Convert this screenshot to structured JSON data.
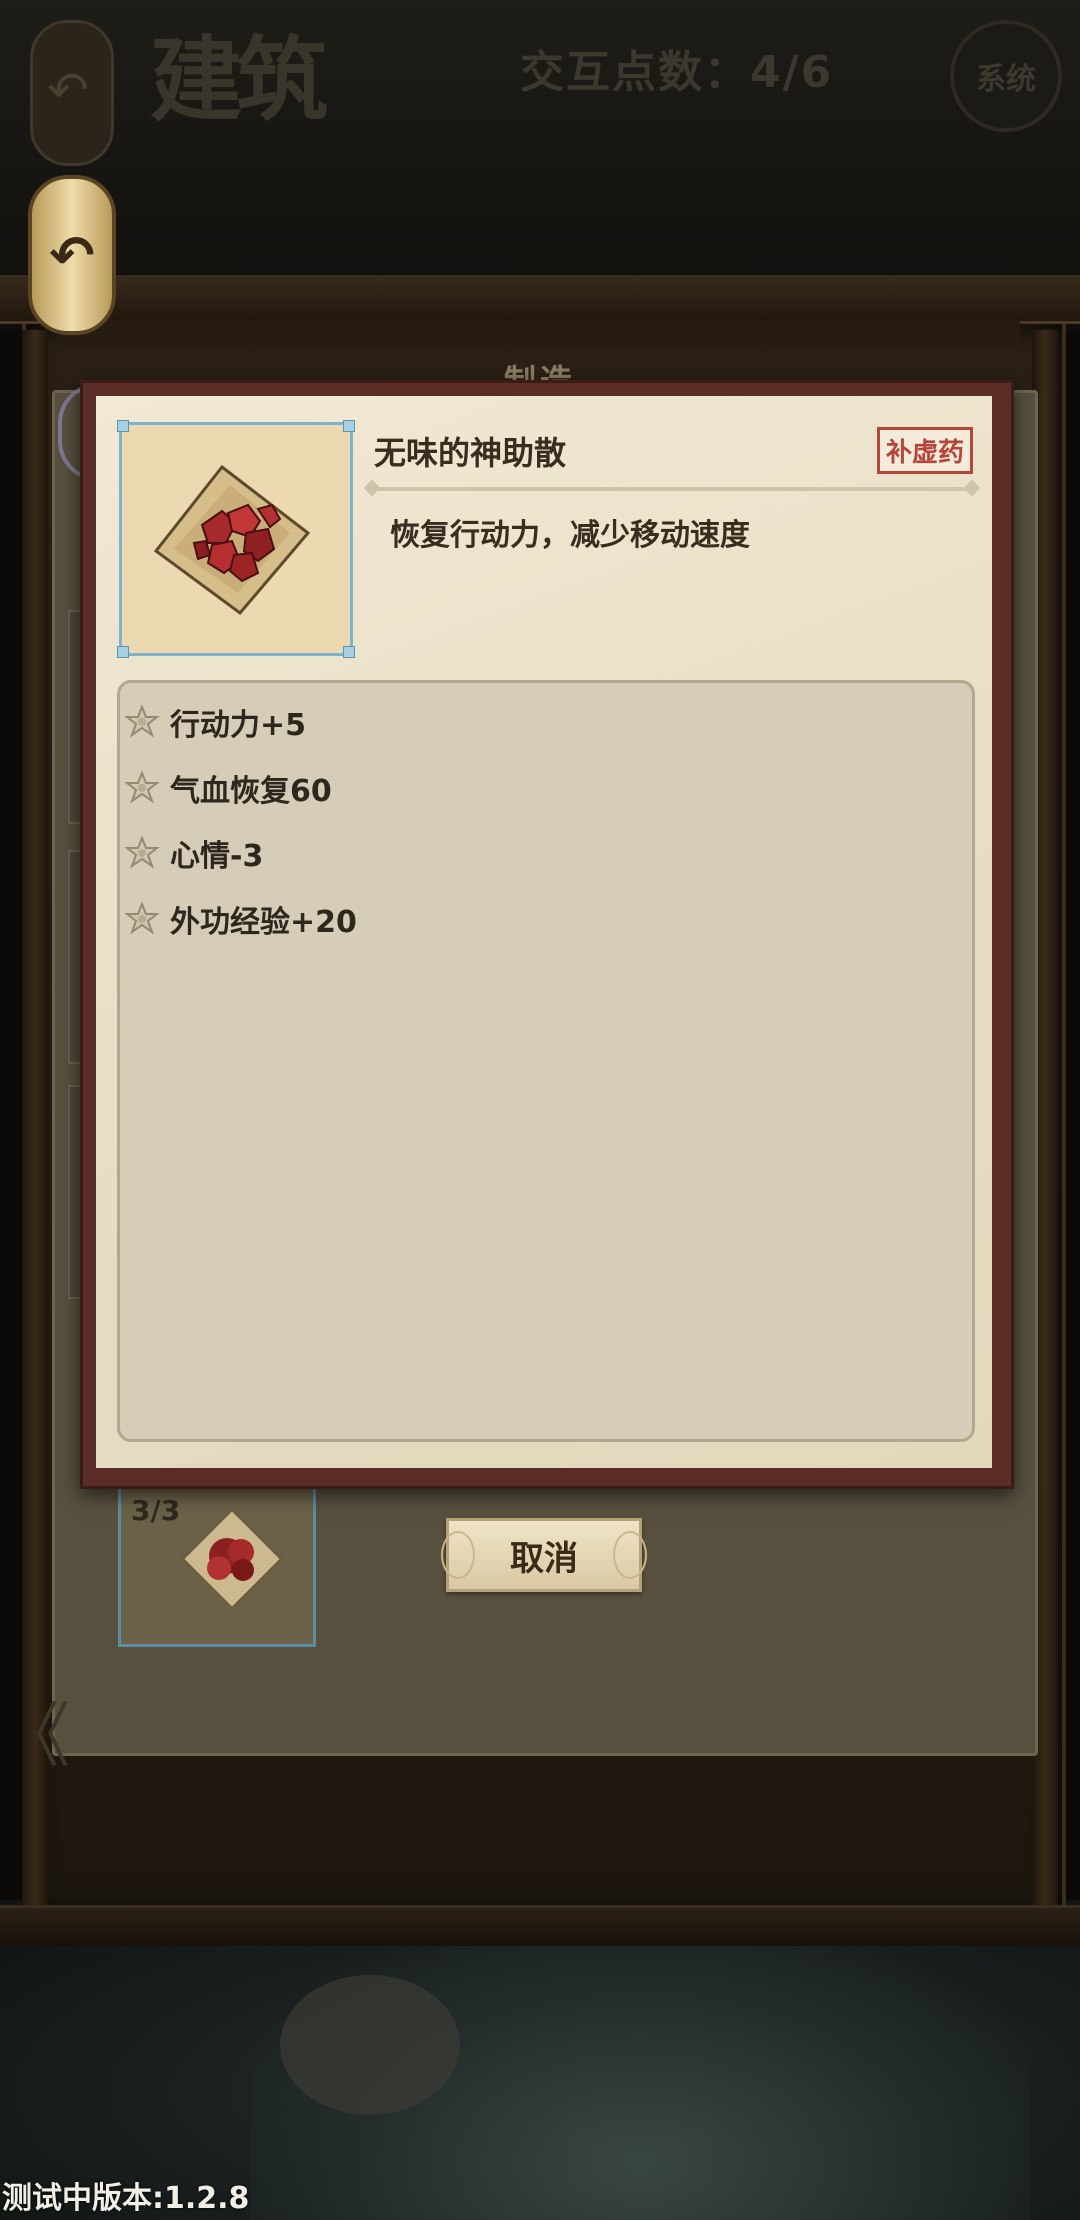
{
  "header": {
    "building_title": "建筑",
    "action_points": "交互点数：4/6",
    "system_label": "系统"
  },
  "panel": {
    "title": "制造",
    "slot_count": "3/3",
    "cancel_label": "取消"
  },
  "dialog": {
    "item_name": "无味的神助散",
    "item_tag": "补虚药",
    "item_desc": "恢复行动力，减少移动速度",
    "effects": [
      "行动力+5",
      "气血恢复60",
      "心情-3",
      "外功经验+20"
    ]
  },
  "footer": {
    "version": "测试中版本:1.2.8"
  },
  "colors": {
    "dialog_border": "#5a2e26",
    "parchment": "#f1e9d4",
    "tag_red": "#b6463b",
    "thumb_border": "#7fb3cc"
  },
  "icons": {
    "back": "back-arrow-icon",
    "effect_bullet": "flower-icon",
    "item": "red-medicine-powder-icon"
  }
}
